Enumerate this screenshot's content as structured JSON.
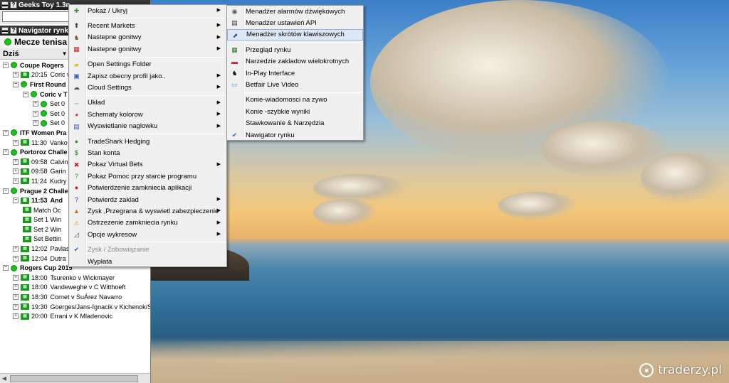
{
  "app": {
    "title": "Geeks Toy 1.3n",
    "navigator_title": "Navigator rynk",
    "search_value": "",
    "category": "Mecze tenisa",
    "day": "Dziś"
  },
  "tree": [
    {
      "type": "group",
      "label": "Coupe Rogers"
    },
    {
      "type": "match",
      "time": "20:15",
      "label": "Coric v"
    },
    {
      "type": "group2",
      "label": "First Round"
    },
    {
      "type": "group3",
      "label": "Coric v T"
    },
    {
      "type": "set",
      "label": "Set 0"
    },
    {
      "type": "set",
      "label": "Set 0"
    },
    {
      "type": "set",
      "label": "Set 0"
    },
    {
      "type": "group",
      "label": "ITF Women Pra"
    },
    {
      "type": "match",
      "time": "11:30",
      "label": "Vanko"
    },
    {
      "type": "group",
      "label": "Portoroz Challe"
    },
    {
      "type": "match",
      "time": "09:58",
      "label": "Calvin"
    },
    {
      "type": "match",
      "time": "09:58",
      "label": "Garin"
    },
    {
      "type": "match",
      "time": "11:24",
      "label": "Kudry"
    },
    {
      "type": "group",
      "label": "Prague 2 Challe"
    },
    {
      "type": "live",
      "time": "11:53",
      "label": "And"
    },
    {
      "type": "market",
      "label": "Match Oc"
    },
    {
      "type": "market",
      "label": "Set 1 Win"
    },
    {
      "type": "market",
      "label": "Set 2 Win"
    },
    {
      "type": "market",
      "label": "Set Bettin"
    },
    {
      "type": "match",
      "time": "12:02",
      "label": "Pavlas"
    },
    {
      "type": "match",
      "time": "12:04",
      "label": "Dutra"
    },
    {
      "type": "group",
      "label": "Rogers Cup 2015"
    },
    {
      "type": "match",
      "time": "18:00",
      "label": "Tsurenko v Wickmayer"
    },
    {
      "type": "match",
      "time": "18:00",
      "label": "Vandeweghe v C Witthoeft"
    },
    {
      "type": "match",
      "time": "18:30",
      "label": "Cornet v SuÁrez Navarro"
    },
    {
      "type": "match",
      "time": "19:30",
      "label": "Goerges/Jans-Ignacik v Kichenok/Save"
    },
    {
      "type": "match",
      "time": "20:00",
      "label": "Errani v K Mladenovic"
    }
  ],
  "main_menu": [
    {
      "label": "Pokaż / Ukryj",
      "icon": "plus-icon",
      "submenu": true
    },
    {
      "sep": true
    },
    {
      "label": "Recent Markets",
      "icon": "recent-icon",
      "submenu": true
    },
    {
      "label": "Nastepne gonitwy",
      "icon": "horse-icon",
      "submenu": true
    },
    {
      "label": "Nastepne gonitwy",
      "icon": "flag-uk-icon",
      "submenu": true
    },
    {
      "sep": true
    },
    {
      "label": "Open Settings Folder",
      "icon": "folder-icon",
      "submenu": false
    },
    {
      "label": "Zapisz obecny profil jako..",
      "icon": "save-icon",
      "submenu": true
    },
    {
      "label": "Cloud Settings",
      "icon": "cloud-icon",
      "submenu": true
    },
    {
      "sep": true
    },
    {
      "label": "Układ",
      "icon": "layout-icon",
      "submenu": true
    },
    {
      "label": "Schematy kolorow",
      "icon": "palette-icon",
      "submenu": true
    },
    {
      "label": "Wyswietlanie naglowku",
      "icon": "header-icon",
      "submenu": true
    },
    {
      "sep": true
    },
    {
      "label": "TradeShark Hedging",
      "icon": "hedging-icon",
      "submenu": false
    },
    {
      "label": "Stan konta",
      "icon": "account-icon",
      "submenu": false
    },
    {
      "label": "Pokaz Virtual Bets",
      "icon": "virtual-bets-icon",
      "submenu": true
    },
    {
      "label": "Pokaz Pomoc przy starcie programu",
      "icon": "help-start-icon",
      "submenu": false
    },
    {
      "label": "Potwierdzenie zamkniecia aplikacji",
      "icon": "confirm-close-icon",
      "submenu": false
    },
    {
      "label": "Potwierdz zaklad",
      "icon": "confirm-bet-icon",
      "submenu": true
    },
    {
      "label": "Zysk ,Przegrana & wyswietl zabezpieczenie",
      "icon": "profit-icon",
      "submenu": true
    },
    {
      "label": "Ostrzezenie zamkniecia rynku",
      "icon": "warning-icon",
      "submenu": true
    },
    {
      "label": "Opcje wykresow",
      "icon": "chart-icon",
      "submenu": true
    },
    {
      "sep": true
    },
    {
      "label": "Zysk / Zobowiązanie",
      "icon": "check-icon",
      "submenu": false,
      "disabled": true
    },
    {
      "label": "Wypłata",
      "icon": "",
      "submenu": false
    }
  ],
  "sub_menu": [
    {
      "label": "Menadżer alarmów dźwiękowych",
      "icon": "sound-icon"
    },
    {
      "label": "Menadżer ustawień API",
      "icon": "api-icon"
    },
    {
      "label": "Menadżer skrótów klawiszowych",
      "icon": "shortcut-icon",
      "highlight": true
    },
    {
      "sep": true
    },
    {
      "label": "Przegląd rynku",
      "icon": "market-overview-icon"
    },
    {
      "label": "Narzedzie zakladow wielokrotnych",
      "icon": "multi-bet-icon"
    },
    {
      "label": "In-Play Interface",
      "icon": "inplay-icon"
    },
    {
      "label": "Betfair Live Video",
      "icon": "video-icon"
    },
    {
      "sep": true
    },
    {
      "label": "Konie-wiadomosci na zywo",
      "icon": ""
    },
    {
      "label": "Konie -szybkie wyniki",
      "icon": ""
    },
    {
      "label": "Stawkowanie & Narzędzia",
      "icon": ""
    },
    {
      "label": "Nawigator rynku",
      "icon": "check-icon"
    }
  ],
  "watermark": "traderzy.pl"
}
